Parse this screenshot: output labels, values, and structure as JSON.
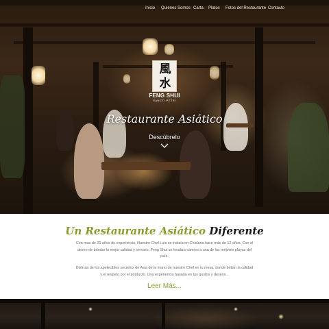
{
  "nav": {
    "items": [
      {
        "label": "Inicio"
      },
      {
        "label": "Quienes Somos"
      },
      {
        "label": "Carta"
      },
      {
        "label": "Platos"
      },
      {
        "label": "Fotos del Restaurante"
      },
      {
        "label": "Contacto"
      }
    ]
  },
  "logo": {
    "glyph_top": "風",
    "glyph_bottom": "水",
    "name": "FENG SHUI",
    "subtitle": "SANCTI PETRI"
  },
  "hero": {
    "title": "Restaurante Asiático",
    "cta_label": "Descúbrelo"
  },
  "intro": {
    "title_accent": "Un Restaurante Asiático",
    "title_dark": "Diferente",
    "paragraph_1": "Con mas de 20 años de experiencia, Nuestro Chef Luis se instala en Chiclana hace más de 12 años. Con el deseo de brindar la mejor calidad y servicio, Feng Shui se localiza camino a una de las mejores playas del país.",
    "paragraph_2": "Disfruta de los apetecibles secretos de Asia de la mano de nuestro Chef en tu mesa, donde brillan la calidad y el respeto por el producto. Una experiencia basada en tus gustos y deseos...",
    "read_more_label": "Leer Más..."
  },
  "colors": {
    "accent": "#8c9a2f",
    "nav_text": "#f1ece2",
    "body_text": "#6b6b6b"
  }
}
